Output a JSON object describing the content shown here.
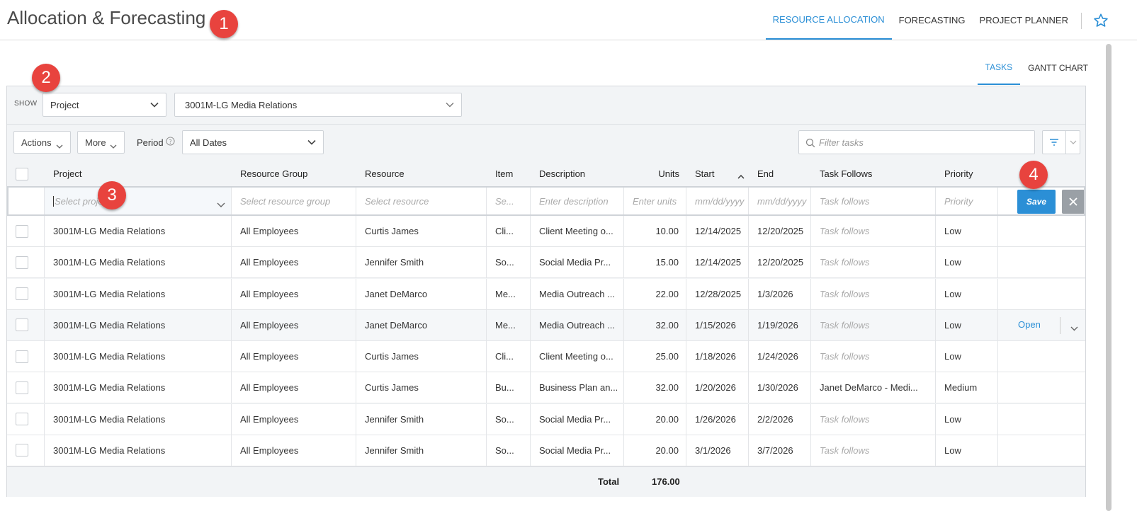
{
  "header": {
    "title": "Allocation & Forecasting",
    "nav": [
      "RESOURCE ALLOCATION",
      "FORECASTING",
      "PROJECT PLANNER"
    ],
    "active_nav": "RESOURCE ALLOCATION"
  },
  "badges": [
    "1",
    "2",
    "3",
    "4"
  ],
  "subtabs": [
    "TASKS",
    "GANTT CHART"
  ],
  "filters": {
    "show_label": "SHOW",
    "show_type": "Project",
    "show_value": "3001M-LG Media Relations",
    "actions_label": "Actions",
    "more_label": "More",
    "period_label": "Period",
    "period_value": "All Dates",
    "filter_placeholder": "Filter tasks"
  },
  "columns": [
    "Project",
    "Resource Group",
    "Resource",
    "Item",
    "Description",
    "Units",
    "Start",
    "End",
    "Task Follows",
    "Priority"
  ],
  "new_row": {
    "project": "Select project",
    "resource_group": "Select resource group",
    "resource": "Select resource",
    "item": "Se...",
    "description": "Enter description",
    "units": "Enter units",
    "start": "mm/dd/yyyy",
    "end": "mm/dd/yyyy",
    "task_follows": "Task follows",
    "priority": "Priority",
    "save_label": "Save"
  },
  "rows": [
    {
      "project": "3001M-LG Media Relations",
      "group": "All Employees",
      "resource": "Curtis James",
      "item": "Cli...",
      "description": "Client Meeting o...",
      "units": "10.00",
      "start": "12/14/2025",
      "end": "12/20/2025",
      "follows": "Task follows",
      "priority": "Low"
    },
    {
      "project": "3001M-LG Media Relations",
      "group": "All Employees",
      "resource": "Jennifer Smith",
      "item": "So...",
      "description": " Social Media Pr...",
      "units": "15.00",
      "start": "12/14/2025",
      "end": "12/20/2025",
      "follows": "Task follows",
      "priority": "Low"
    },
    {
      "project": "3001M-LG Media Relations",
      "group": "All Employees",
      "resource": "Janet DeMarco",
      "item": "Me...",
      "description": "Media Outreach ...",
      "units": "22.00",
      "start": "12/28/2025",
      "end": "1/3/2026",
      "follows": "Task follows",
      "priority": "Low"
    },
    {
      "project": "3001M-LG Media Relations",
      "group": "All Employees",
      "resource": "Janet DeMarco",
      "item": "Me...",
      "description": "Media Outreach ...",
      "units": "32.00",
      "start": "1/15/2026",
      "end": "1/19/2026",
      "follows": "Task follows",
      "priority": "Low",
      "action": "Open"
    },
    {
      "project": "3001M-LG Media Relations",
      "group": "All Employees",
      "resource": "Curtis James",
      "item": "Cli...",
      "description": "Client Meeting o...",
      "units": "25.00",
      "start": "1/18/2026",
      "end": "1/24/2026",
      "follows": "Task follows",
      "priority": "Low"
    },
    {
      "project": "3001M-LG Media Relations",
      "group": "All Employees",
      "resource": "Curtis James",
      "item": "Bu...",
      "description": "Business Plan an...",
      "units": "32.00",
      "start": "1/20/2026",
      "end": "1/30/2026",
      "follows": "Janet DeMarco - Medi...",
      "priority": "Medium"
    },
    {
      "project": "3001M-LG Media Relations",
      "group": "All Employees",
      "resource": "Jennifer Smith",
      "item": "So...",
      "description": " Social Media Pr...",
      "units": "20.00",
      "start": "1/26/2026",
      "end": "2/2/2026",
      "follows": "Task follows",
      "priority": "Low"
    },
    {
      "project": "3001M-LG Media Relations",
      "group": "All Employees",
      "resource": "Jennifer Smith",
      "item": "So...",
      "description": " Social Media Pr...",
      "units": "20.00",
      "start": "3/1/2026",
      "end": "3/7/2026",
      "follows": "Task follows",
      "priority": "Low"
    }
  ],
  "total": {
    "label": "Total",
    "value": "176.00"
  },
  "colors": {
    "accent": "#2b8fd6",
    "badge": "#e8433e",
    "close": "#9aa0a6"
  }
}
